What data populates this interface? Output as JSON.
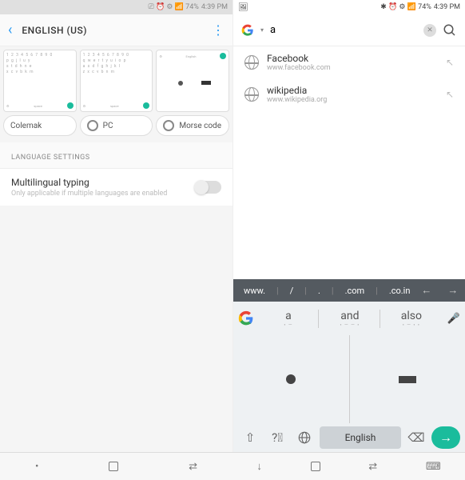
{
  "left": {
    "status": {
      "icons": "⎚ ⏰ ⚙ 📶 74%",
      "time": "4:39 PM"
    },
    "header": {
      "title": "ENGLISH (US)"
    },
    "radios": [
      "Colemak",
      "PC",
      "Morse code"
    ],
    "section": "LANGUAGE SETTINGS",
    "setting": {
      "title": "Multilingual typing",
      "sub": "Only applicable if multiple languages are enabled"
    }
  },
  "right": {
    "status": {
      "icons": "✱ ⏰ ⚙ 📶 74%",
      "time": "4:39 PM"
    },
    "search": {
      "value": "a"
    },
    "suggestions": [
      {
        "name": "Facebook",
        "url": "www.facebook.com"
      },
      {
        "name": "wikipedia",
        "url": "www.wikipedia.org"
      }
    ],
    "keyboard": {
      "url": {
        "www": "www.",
        "slash": "/",
        "dot": ".",
        "com": ".com",
        "coin": ".co.in"
      },
      "cands": [
        "a",
        "and",
        "also"
      ],
      "lang": "English"
    }
  }
}
